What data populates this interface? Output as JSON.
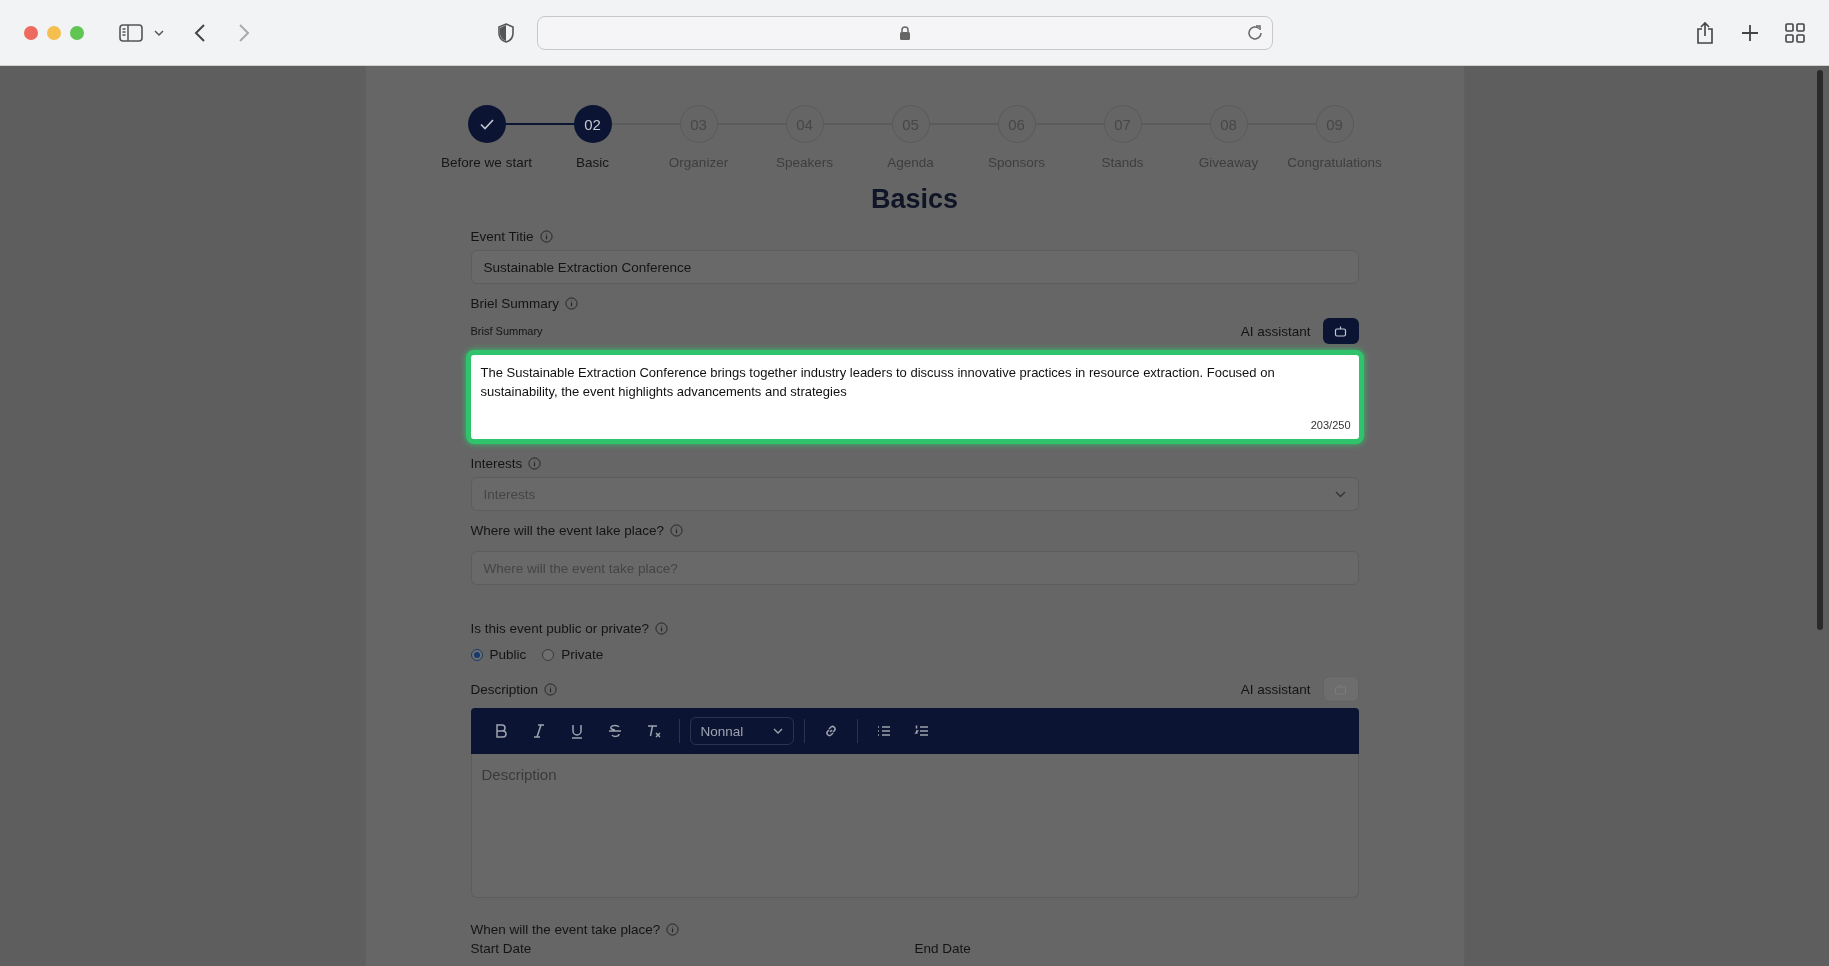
{
  "steps": [
    {
      "label": "Before we start",
      "completed": true,
      "selected": false
    },
    {
      "number": "02",
      "label": "Basic",
      "completed": false,
      "selected": true
    },
    {
      "number": "03",
      "label": "Organizer",
      "completed": false,
      "selected": false
    },
    {
      "number": "04",
      "label": "Speakers",
      "completed": false,
      "selected": false
    },
    {
      "number": "05",
      "label": "Agenda",
      "completed": false,
      "selected": false
    },
    {
      "number": "06",
      "label": "Sponsors",
      "completed": false,
      "selected": false
    },
    {
      "number": "07",
      "label": "Stands",
      "completed": false,
      "selected": false
    },
    {
      "number": "08",
      "label": "Giveaway",
      "completed": false,
      "selected": false
    },
    {
      "number": "09",
      "label": "Congratulations",
      "completed": false,
      "selected": false
    }
  ],
  "form": {
    "title": "Basics",
    "event_title": {
      "label": "Event Titie",
      "value": "Sustainable Extraction Conference"
    },
    "brief_summary": {
      "label": "Briel Summary",
      "sublabel": "Brisf Summary",
      "ai_label": "AI assistant",
      "value": "The Sustainable Extraction Conference brings together industry leaders to discuss innovative practices in resource extraction. Focused on sustainability, the event highlights advancements and strategies",
      "counter": "203/250",
      "highlighted": true
    },
    "interests": {
      "label": "Interests",
      "placeholder": "Interests"
    },
    "location": {
      "label": "Where will the event lake place?",
      "placeholder": "Where will the event take place?"
    },
    "visibility": {
      "label": "Is this event public or private?",
      "options": [
        {
          "label": "Public",
          "selected": true
        },
        {
          "label": "Private",
          "selected": false
        }
      ]
    },
    "description": {
      "label": "Description",
      "ai_label": "AI assistant",
      "ai_enabled": false,
      "format": "Nonnal",
      "placeholder": "Description"
    },
    "dates": {
      "label": "When will the event take place?",
      "start_label": "Start Date",
      "end_label": "End Date"
    }
  }
}
